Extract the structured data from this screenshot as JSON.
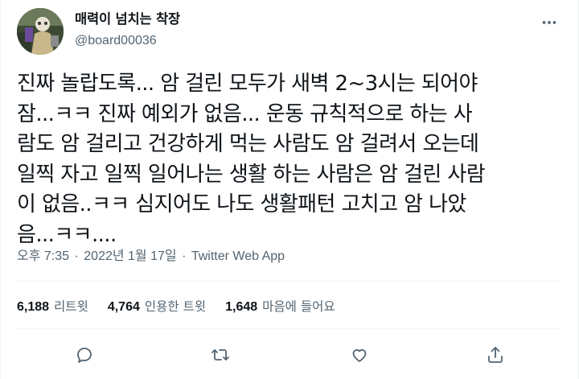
{
  "user": {
    "display_name": "매력이 넘치는 착장",
    "handle": "@board00036",
    "avatar_icon": "profile-avatar"
  },
  "tweet": {
    "lines": [
      "진짜 놀랍도록... 암 걸린 모두가 새벽 2~3시는 되어야",
      "잠...ㅋㅋ 진짜 예외가 없음... 운동 규칙적으로 하는 사",
      "람도 암 걸리고 건강하게 먹는 사람도 암 걸려서 오는데",
      "일찍 자고 일찍 일어나는 생활 하는 사람은 암 걸린 사람",
      "이 없음..ㅋㅋ 심지어도 나도 생활패턴 고치고 암 나았",
      "음...ㅋㅋ...."
    ]
  },
  "meta": {
    "time": "오후 7:35",
    "separator": "·",
    "date": "2022년 1월 17일",
    "source": "Twitter Web App"
  },
  "stats": {
    "retweets_count": "6,188",
    "retweets_label": "리트윗",
    "quotes_count": "4,764",
    "quotes_label": "인용한 트윗",
    "likes_count": "1,648",
    "likes_label": "마음에 들어요"
  },
  "colors": {
    "text": "#0f1419",
    "secondary": "#536471",
    "divider": "#eff3f4"
  }
}
